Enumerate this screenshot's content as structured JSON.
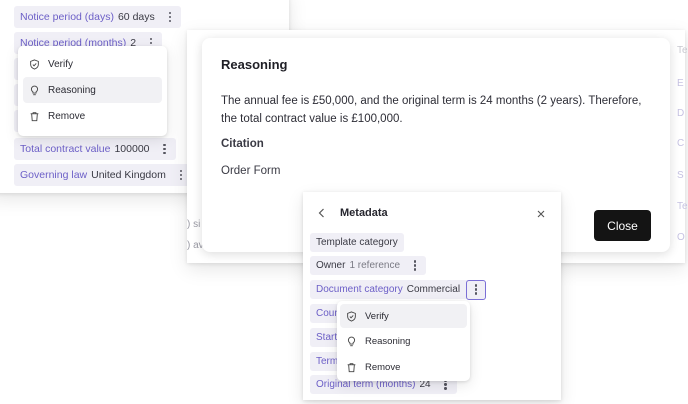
{
  "left_panel": {
    "chips": [
      {
        "key": "Notice period (days)",
        "value": "60 days"
      },
      {
        "key": "Notice period (months)",
        "value": "2"
      },
      {
        "key": "Total contract value",
        "value": "100000"
      },
      {
        "key": "Governing law",
        "value": "United Kingdom"
      }
    ],
    "menu": {
      "verify": "Verify",
      "reasoning": "Reasoning",
      "remove": "Remove"
    }
  },
  "reasoning_modal": {
    "title": "Reasoning",
    "body": "The annual fee is £50,000, and the original term is 24 months (2 years). Therefore, the total contract value is £100,000.",
    "citation_heading": "Citation",
    "citation_text": "Order Form",
    "close_label": "Close"
  },
  "metadata_panel": {
    "title": "Metadata",
    "chips": {
      "template_category": "Template category",
      "owner_key": "Owner",
      "owner_value": "1 reference",
      "doc_category_key": "Document category",
      "doc_category_value": "Commercial",
      "original_term_key": "Original term (months)",
      "original_term_value": "24"
    },
    "partial": {
      "coun": "Coun",
      "start": "Start",
      "term": "Term"
    },
    "menu": {
      "verify": "Verify",
      "reasoning": "Reasoning",
      "remove": "Remove"
    }
  },
  "background_fragments": {
    "right_edge": [
      "Te",
      "E",
      "D",
      "C",
      "S",
      "Te",
      "O"
    ],
    "left_edge": [
      ") si",
      ") av"
    ]
  },
  "colors": {
    "accent": "#6c5fc7",
    "chip_bg": "#f0eff6",
    "close_btn": "#141414"
  }
}
